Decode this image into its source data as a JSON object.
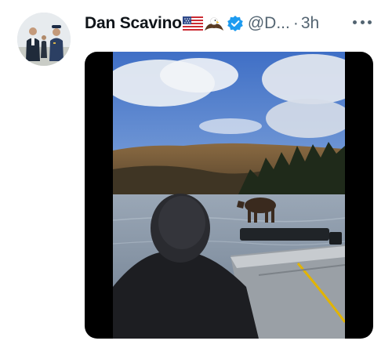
{
  "tweet": {
    "author_name": "Dan Scavino",
    "handle": "@D...",
    "separator": "·",
    "timestamp": "3h",
    "emojis": [
      "flag-usa-emoji",
      "eagle-emoji"
    ],
    "verified": true
  },
  "colors": {
    "name": "#0f1419",
    "secondary_text": "#536471",
    "verified_blue": "#1d9bf0",
    "media_background": "#000000"
  },
  "icons": {
    "more": "more-horizontal-icon",
    "verified": "verified-badge-icon"
  }
}
